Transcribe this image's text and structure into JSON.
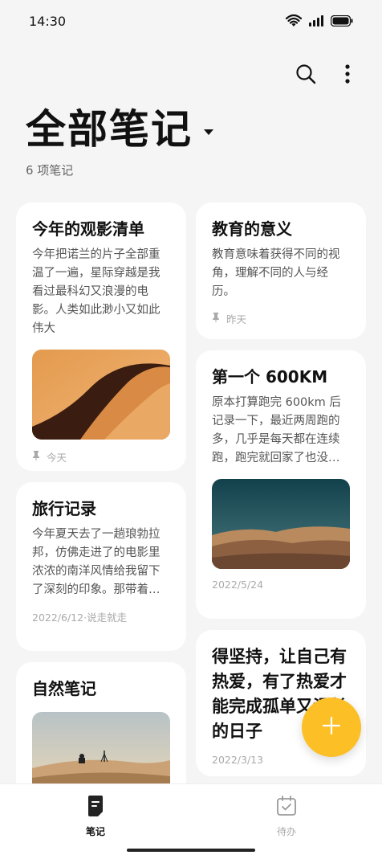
{
  "status_bar": {
    "time": "14:30"
  },
  "header": {
    "title": "全部笔记",
    "count": "6 项笔记"
  },
  "notes_left": [
    {
      "title": "今年的观影清单",
      "body": "今年把诺兰的片子全部重温了一遍，星际穿越是我看过最科幻又浪漫的电影。人类如此渺小又如此伟大",
      "image": "desert-dune-orange",
      "footer": "今天",
      "pinned": true
    },
    {
      "title": "旅行记录",
      "body": "今年夏天去了一趟琅勃拉邦，仿佛走进了的电影里浓浓的南洋风情给我留下了深刻的印象。那带着雨水腥气的宽大…",
      "footer": "2022/6/12·说走就走",
      "pinned": false
    },
    {
      "title": "自然笔记",
      "image": "desert-sunset-people",
      "pinned": false
    }
  ],
  "notes_right": [
    {
      "title": "教育的意义",
      "body": "教育意味着获得不同的视角，理解不同的人与经历。",
      "footer": "昨天",
      "pinned": true
    },
    {
      "title": "第一个 600KM",
      "body": "原本打算跑完 600km 后记录一下，最近两周跑的多，几乎是每天都在连续跑，跑完就回家了也没看记录。今天拉…",
      "image": "desert-dunes-teal-sky",
      "footer": "2022/5/24",
      "pinned": false
    },
    {
      "title": "得坚持，让自己有热爱，有了热爱才能完成孤单又漫长的日子",
      "footer": "2022/3/13",
      "pinned": false
    }
  ],
  "fab": {
    "icon": "plus-icon"
  },
  "bottom_nav": {
    "tabs": [
      {
        "label": "笔记",
        "icon": "note-icon",
        "active": true
      },
      {
        "label": "待办",
        "icon": "todo-icon",
        "active": false
      }
    ]
  },
  "colors": {
    "accent": "#fcbf26",
    "background": "#f5f5f5",
    "card": "#ffffff"
  }
}
